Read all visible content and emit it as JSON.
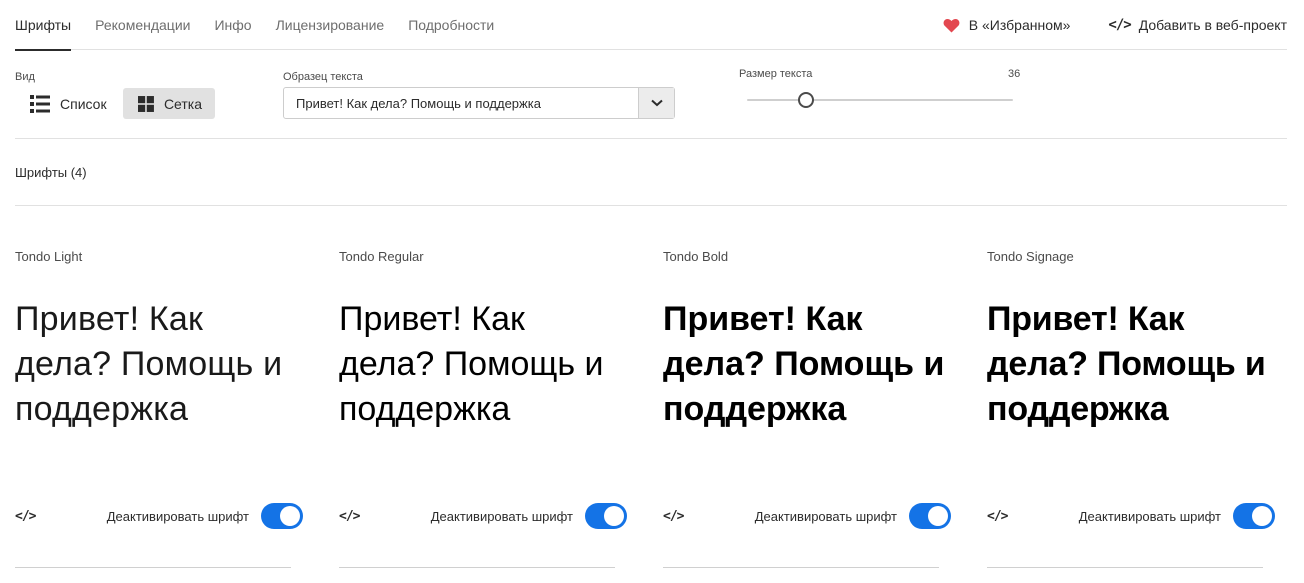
{
  "tabs": [
    {
      "label": "Шрифты",
      "active": true
    },
    {
      "label": "Рекомендации",
      "active": false
    },
    {
      "label": "Инфо",
      "active": false
    },
    {
      "label": "Лицензирование",
      "active": false
    },
    {
      "label": "Подробности",
      "active": false
    }
  ],
  "actions": {
    "favorite_label": "В «Избранном»",
    "favorite_icon": "heart-icon",
    "favorite_color": "#e34850",
    "web_project_label": "Добавить в веб-проект",
    "web_project_icon": "code-icon"
  },
  "view": {
    "label": "Вид",
    "list_label": "Список",
    "grid_label": "Сетка",
    "selected": "grid"
  },
  "sample": {
    "label": "Образец текста",
    "value": "Привет! Как дела? Помощь и поддержка"
  },
  "text_size": {
    "label": "Размер текста",
    "value": "36",
    "slider_fraction": 0.22
  },
  "fonts_count_label": "Шрифты (4)",
  "accent_color": "#1473e6",
  "fonts": [
    {
      "name": "Tondo Light",
      "sample": "Привет! Как дела? Помощь и поддержка",
      "deactivate_label": "Деактивировать шрифт",
      "active": true
    },
    {
      "name": "Tondo Regular",
      "sample": "Привет! Как дела? Помощь и поддержка",
      "deactivate_label": "Деактивировать шрифт",
      "active": true
    },
    {
      "name": "Tondo Bold",
      "sample": "Привет! Как дела? Помощь и поддержка",
      "deactivate_label": "Деактивировать шрифт",
      "active": true
    },
    {
      "name": "Tondo Signage",
      "sample": "Привет! Как дела? Помощь и поддержка",
      "deactivate_label": "Деактивировать шрифт",
      "active": true
    }
  ]
}
